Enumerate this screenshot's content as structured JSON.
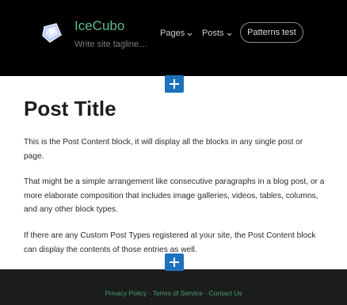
{
  "site": {
    "title": "IceCubo",
    "tagline": "Write site tagline…"
  },
  "nav": {
    "items": [
      {
        "label": "Pages"
      },
      {
        "label": "Posts"
      }
    ],
    "button_label": "Patterns test"
  },
  "post": {
    "title": "Post Title",
    "paragraphs": [
      "This is the Post Content block, it will display all the blocks in any single post or page.",
      "That might be a simple arrangement like consecutive paragraphs in a blog post, or a more elaborate composition that includes image galleries, videos, tables, columns, and any other block types.",
      "If there are any Custom Post Types registered at your site, the Post Content block can display the contents of those entries as well."
    ]
  },
  "footer": {
    "links": [
      "Privacy Policy",
      "Terms of Service",
      "Contact Us"
    ],
    "separator": "·"
  },
  "colors": {
    "header_bg": "#000000",
    "accent_green": "#5fbe86",
    "add_block_blue": "#1e72bd",
    "footer_bg": "#1a1d1c"
  },
  "icons": [
    "site-logo-icon",
    "chevron-down-icon",
    "plus-icon"
  ]
}
